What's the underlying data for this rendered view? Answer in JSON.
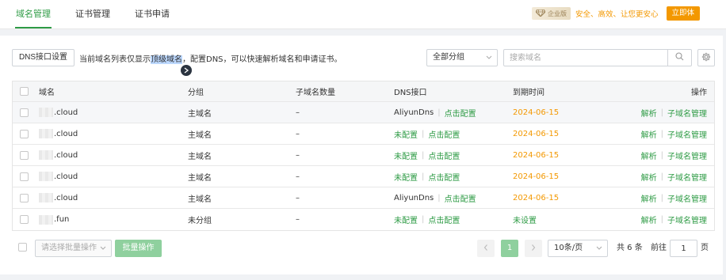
{
  "tabs": [
    {
      "label": "域名管理",
      "active": true
    },
    {
      "label": "证书管理",
      "active": false
    },
    {
      "label": "证书申请",
      "active": false
    }
  ],
  "promo": {
    "badge_label": "企业版",
    "text": "安全、高效、让您更安心",
    "buy_label": "立即体"
  },
  "toolbar": {
    "dns_button": "DNS接口设置",
    "hint_before": "当前域名列表仅显示",
    "hint_highlight": "顶级域名",
    "hint_after": "，配置DNS，可以快速解析域名和申请证书。",
    "group_select": "全部分组",
    "search_placeholder": "搜索域名"
  },
  "table": {
    "headers": [
      "域名",
      "分组",
      "子域名数量",
      "DNS接口",
      "到期时间",
      "操作"
    ],
    "rows": [
      {
        "domain": ".cloud",
        "group": "主域名",
        "subcount": "–",
        "dns": "AliyunDns",
        "dns_action": "点击配置",
        "dns_configured": true,
        "expiry": "2024-06-15",
        "action1": "解析",
        "action2": "子域名管理"
      },
      {
        "domain": ".cloud",
        "group": "主域名",
        "subcount": "–",
        "dns": "未配置",
        "dns_action": "点击配置",
        "dns_configured": false,
        "expiry": "2024-06-15",
        "action1": "解析",
        "action2": "子域名管理"
      },
      {
        "domain": ".cloud",
        "group": "主域名",
        "subcount": "–",
        "dns": "未配置",
        "dns_action": "点击配置",
        "dns_configured": false,
        "expiry": "2024-06-15",
        "action1": "解析",
        "action2": "子域名管理"
      },
      {
        "domain": ".cloud",
        "group": "主域名",
        "subcount": "–",
        "dns": "未配置",
        "dns_action": "点击配置",
        "dns_configured": false,
        "expiry": "2024-06-15",
        "action1": "解析",
        "action2": "子域名管理"
      },
      {
        "domain": ".cloud",
        "group": "主域名",
        "subcount": "–",
        "dns": "AliyunDns",
        "dns_action": "点击配置",
        "dns_configured": true,
        "expiry": "2024-06-15",
        "action1": "解析",
        "action2": "子域名管理"
      },
      {
        "domain": ".fun",
        "group": "未分组",
        "subcount": "–",
        "dns": "未配置",
        "dns_action": "点击配置",
        "dns_configured": false,
        "expiry": "未设置",
        "action1": "解析",
        "action2": "子域名管理"
      }
    ]
  },
  "footer": {
    "batch_select_placeholder": "请选择批量操作",
    "batch_button": "批量操作",
    "current_page": "1",
    "page_size": "10条/页",
    "total_text": "共 6 条",
    "goto_label": "前往",
    "goto_value": "1",
    "page_unit": "页"
  },
  "colors": {
    "accent": "#2e9b45",
    "warning": "#f39800"
  },
  "icons": [
    "diamond-icon",
    "search-icon",
    "gear-icon",
    "floating-assistant-icon",
    "chevron-down-icon",
    "chevron-left-icon",
    "chevron-right-icon"
  ]
}
